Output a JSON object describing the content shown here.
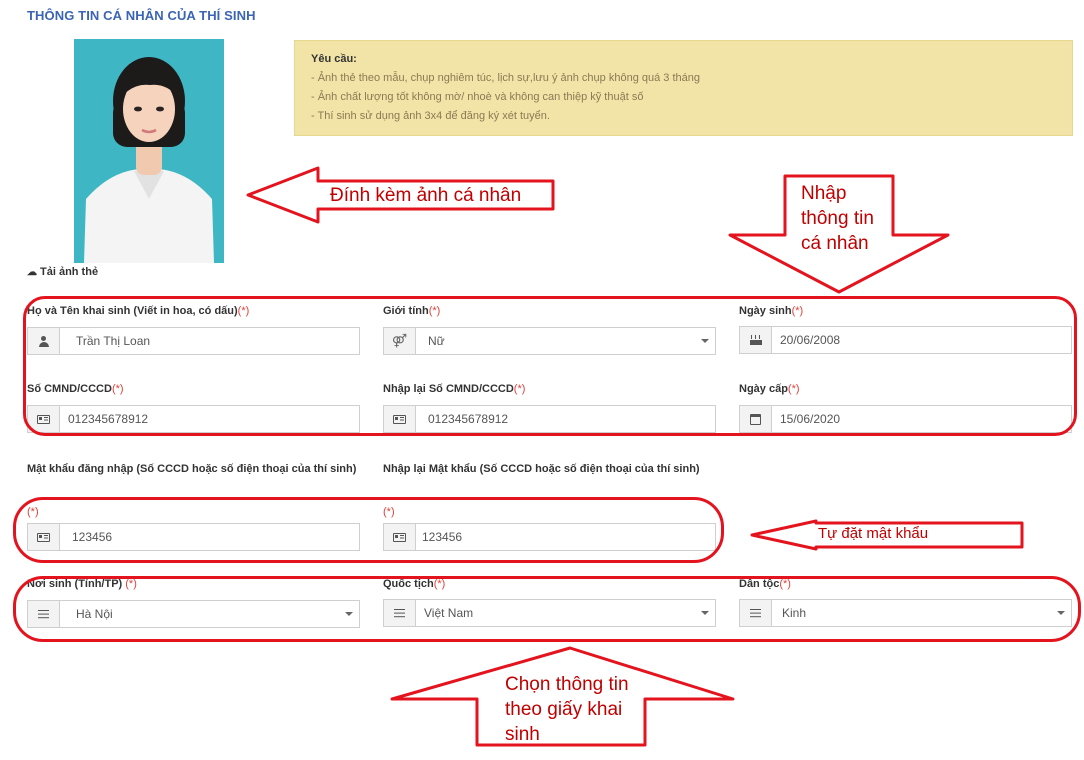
{
  "section_title": "THÔNG TIN CÁ NHÂN CỦA THÍ SINH",
  "upload": {
    "icon": "cloud-upload-icon",
    "label": "Tải ảnh thẻ"
  },
  "requirements": {
    "title": "Yêu cầu:",
    "lines": [
      "- Ảnh thẻ theo mẫu, chụp nghiêm túc, lịch sự,lưu ý ảnh chụp không quá 3 tháng",
      "- Ảnh chất lượng tốt không mờ/ nhoè và không can thiệp kỹ thuật số",
      "- Thí sinh sử dụng ảnh 3x4 để đăng ký xét tuyển."
    ]
  },
  "form": {
    "required_mark": "(*)",
    "full_name": {
      "label": "Họ và Tên khai sinh (Viết in hoa, có dấu)",
      "value": "Trần Thị Loan",
      "icon": "user-icon"
    },
    "gender": {
      "label": "Giới tính",
      "value": "Nữ",
      "icon": "gender-icon"
    },
    "birth_date": {
      "label": "Ngày sinh",
      "value": "20/06/2008",
      "icon": "birthday-cake-icon"
    },
    "id_number": {
      "label": "Số CMND/CCCD",
      "value": "012345678912",
      "icon": "id-card-icon"
    },
    "id_number_confirm": {
      "label": "Nhập lại Số CMND/CCCD",
      "value": "012345678912",
      "icon": "id-card-icon"
    },
    "issue_date": {
      "label": "Ngày cấp",
      "value": "15/06/2020",
      "icon": "calendar-icon"
    },
    "password": {
      "label": "Mật khẩu đăng nhập (Số CCCD hoặc số điện thoại của thí sinh)",
      "value": "123456",
      "icon": "id-card-icon"
    },
    "password_confirm": {
      "label": "Nhập lại Mật khẩu (Số CCCD hoặc số điện thoại của thí sinh)",
      "value": "123456",
      "icon": "id-card-icon"
    },
    "birth_place": {
      "label": "Nơi sinh (Tỉnh/TP)",
      "value": "Hà Nội",
      "icon": "list-icon"
    },
    "nationality": {
      "label": "Quốc tịch",
      "value": "Việt Nam",
      "icon": "list-icon"
    },
    "ethnicity": {
      "label": "Dân tộc",
      "value": "Kinh",
      "icon": "list-icon"
    }
  },
  "annotations": {
    "attach_photo": "Đính kèm ảnh cá nhân",
    "enter_info": [
      "Nhập",
      "thông tin",
      "cá nhân"
    ],
    "set_password": "Tự đặt mật khẩu",
    "choose_info": [
      "Chọn thông tin",
      "theo giấy khai",
      "sinh"
    ]
  },
  "colors": {
    "title_blue": "#3b64b4",
    "annotation_red": "#e3141e",
    "required_red": "#e0403a",
    "req_box_bg": "#f2e4a6",
    "photo_bg": "#3fb6c3"
  }
}
